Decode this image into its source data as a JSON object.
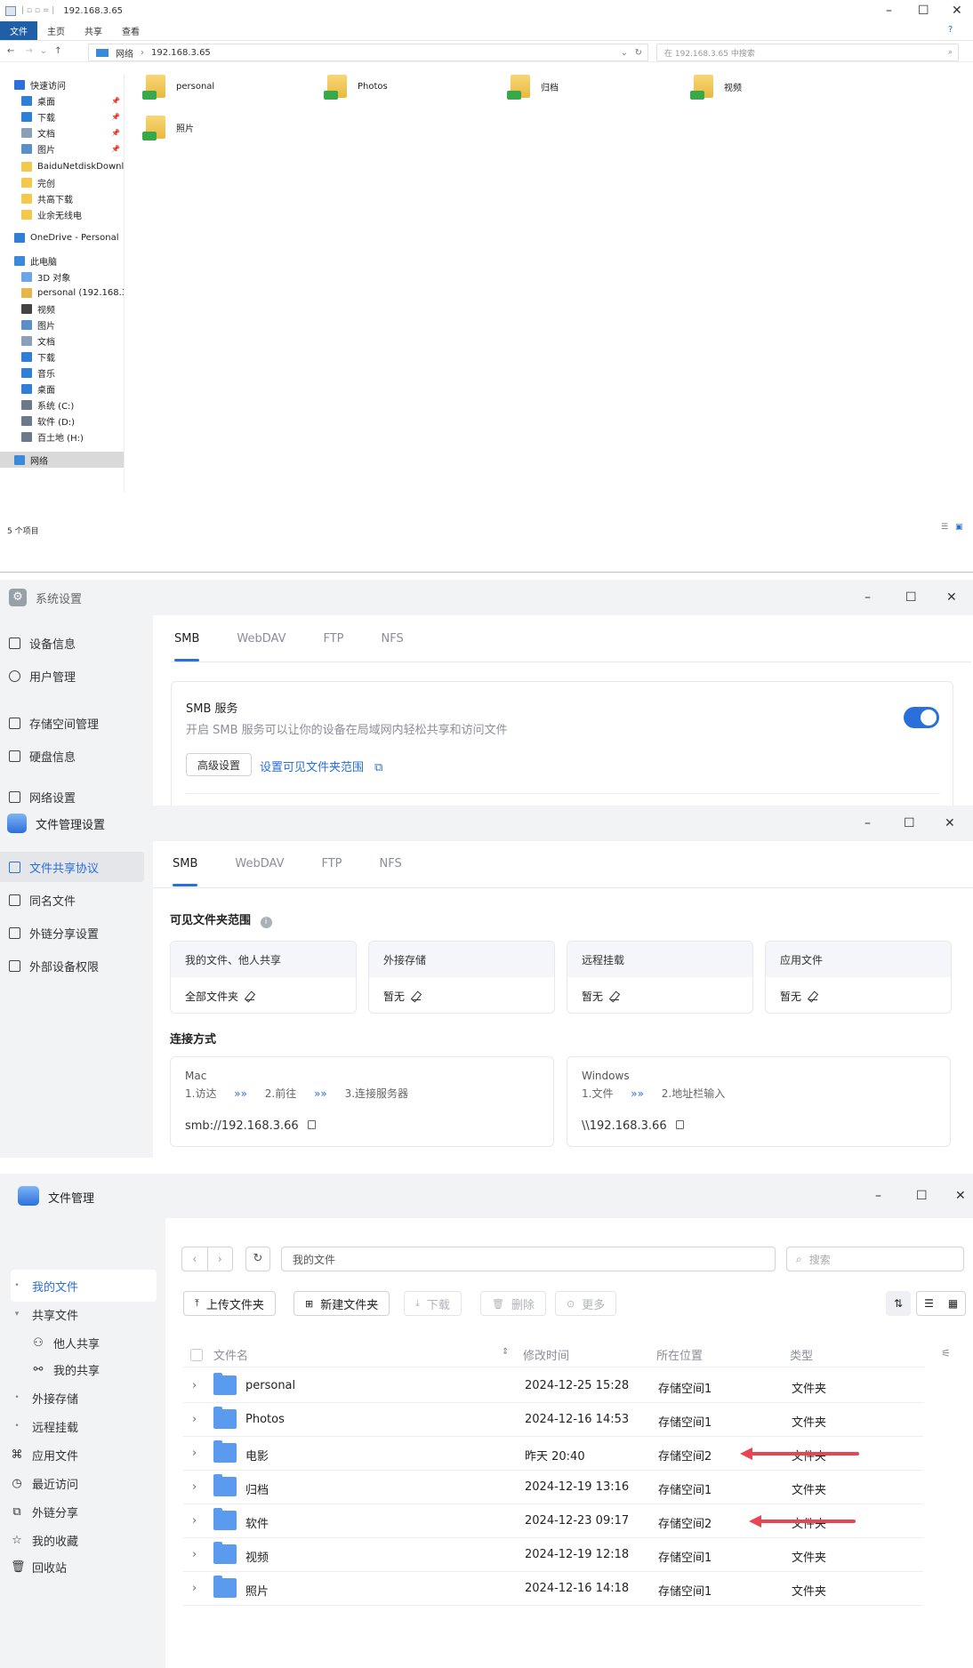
{
  "explorer": {
    "title": "192.168.3.65",
    "ribbon_tabs": [
      "文件",
      "主页",
      "共享",
      "查看"
    ],
    "breadcrumb_root": "网络",
    "breadcrumb_path": "192.168.3.65",
    "search_placeholder": "在 192.168.3.65 中搜索",
    "nav": [
      {
        "label": "快速访问",
        "icon": "star-icon",
        "color": "#2a6fdb",
        "pinned": false
      },
      {
        "label": "桌面",
        "icon": "desktop-icon",
        "color": "#2f7fd6",
        "pinned": true
      },
      {
        "label": "下载",
        "icon": "download-icon",
        "color": "#2f7fd6",
        "pinned": true
      },
      {
        "label": "文档",
        "icon": "document-icon",
        "color": "#8aa0b8",
        "pinned": true
      },
      {
        "label": "图片",
        "icon": "picture-icon",
        "color": "#5b8fc8",
        "pinned": true
      },
      {
        "label": "BaiduNetdiskDownlo",
        "icon": "folder-icon",
        "color": "#f2c94c",
        "pinned": false
      },
      {
        "label": "完创",
        "icon": "folder-icon",
        "color": "#f2c94c",
        "pinned": false
      },
      {
        "label": "共高下载",
        "icon": "folder-icon",
        "color": "#f2c94c",
        "pinned": false
      },
      {
        "label": "业余无线电",
        "icon": "folder-icon",
        "color": "#f2c94c",
        "pinned": false
      },
      {
        "label": "OneDrive - Personal",
        "icon": "cloud-icon",
        "color": "#2f7fd6",
        "pinned": false
      },
      {
        "label": "此电脑",
        "icon": "computer-icon",
        "color": "#3b8ad9",
        "pinned": false
      },
      {
        "label": "3D 对象",
        "icon": "cube-icon",
        "color": "#6aa6e8",
        "pinned": false
      },
      {
        "label": "personal (192.168.3.6",
        "icon": "network-drive-icon",
        "color": "#e5b64a",
        "pinned": false
      },
      {
        "label": "视频",
        "icon": "video-icon",
        "color": "#444",
        "pinned": false
      },
      {
        "label": "图片",
        "icon": "picture-icon",
        "color": "#5b8fc8",
        "pinned": false
      },
      {
        "label": "文档",
        "icon": "document-icon",
        "color": "#8aa0b8",
        "pinned": false
      },
      {
        "label": "下载",
        "icon": "download-icon",
        "color": "#2f7fd6",
        "pinned": false
      },
      {
        "label": "音乐",
        "icon": "music-icon",
        "color": "#2f7fd6",
        "pinned": false
      },
      {
        "label": "桌面",
        "icon": "desktop-icon",
        "color": "#2f7fd6",
        "pinned": false
      },
      {
        "label": "系统 (C:)",
        "icon": "drive-icon",
        "color": "#6a7a8a",
        "pinned": false
      },
      {
        "label": "软件 (D:)",
        "icon": "drive-icon",
        "color": "#6a7a8a",
        "pinned": false
      },
      {
        "label": "百土地 (H:)",
        "icon": "drive-icon",
        "color": "#6a7a8a",
        "pinned": false
      },
      {
        "label": "网络",
        "icon": "network-icon",
        "color": "#3b8ad9",
        "pinned": false
      }
    ],
    "folders": [
      "personal",
      "Photos",
      "归档",
      "视频",
      "照片"
    ],
    "status": "5 个项目"
  },
  "sys_settings": {
    "title": "系统设置",
    "sidebar": [
      "设备信息",
      "用户管理",
      "存储空间管理",
      "硬盘信息",
      "网络设置"
    ],
    "tabs": [
      "SMB",
      "WebDAV",
      "FTP",
      "NFS"
    ],
    "smb_title": "SMB 服务",
    "smb_desc": "开启 SMB 服务可以让你的设备在局域网内轻松共享和访问文件",
    "advanced_btn": "高级设置",
    "scope_link": "设置可见文件夹范围"
  },
  "file_settings": {
    "title": "文件管理设置",
    "sidebar": [
      "文件共享协议",
      "同名文件",
      "外链分享设置",
      "外部设备权限"
    ],
    "tabs": [
      "SMB",
      "WebDAV",
      "FTP",
      "NFS"
    ],
    "scope_heading": "可见文件夹范围",
    "scope_cards": [
      {
        "head": "我的文件、他人共享",
        "value": "全部文件夹"
      },
      {
        "head": "外接存储",
        "value": "暂无"
      },
      {
        "head": "远程挂载",
        "value": "暂无"
      },
      {
        "head": "应用文件",
        "value": "暂无"
      }
    ],
    "connect_heading": "连接方式",
    "mac": {
      "os": "Mac",
      "steps": [
        "1.访达",
        "2.前往",
        "3.连接服务器"
      ],
      "address": "smb://192.168.3.66"
    },
    "windows": {
      "os": "Windows",
      "steps": [
        "1.文件",
        "2.地址栏输入"
      ],
      "address": "\\\\192.168.3.66"
    },
    "step_sep": "»»"
  },
  "file_manager": {
    "title": "文件管理",
    "sidebar": [
      {
        "label": "我的文件",
        "prefix": "•",
        "active": true
      },
      {
        "label": "共享文件",
        "prefix": "▾",
        "active": false
      },
      {
        "label": "他人共享",
        "prefix": "",
        "active": false
      },
      {
        "label": "我的共享",
        "prefix": "",
        "active": false
      },
      {
        "label": "外接存储",
        "prefix": "•",
        "active": false
      },
      {
        "label": "远程挂载",
        "prefix": "•",
        "active": false
      },
      {
        "label": "应用文件",
        "prefix": "",
        "active": false
      },
      {
        "label": "最近访问",
        "prefix": "",
        "active": false
      },
      {
        "label": "外链分享",
        "prefix": "",
        "active": false
      },
      {
        "label": "我的收藏",
        "prefix": "",
        "active": false
      },
      {
        "label": "回收站",
        "prefix": "",
        "active": false
      }
    ],
    "path": "我的文件",
    "search_placeholder": "搜索",
    "toolbar": [
      "上传文件夹",
      "新建文件夹",
      "下载",
      "删除",
      "更多"
    ],
    "columns": [
      "文件名",
      "修改时间",
      "所在位置",
      "类型"
    ],
    "rows": [
      {
        "name": "personal",
        "modified": "2024-12-25 15:28",
        "location": "存储空间1",
        "type": "文件夹"
      },
      {
        "name": "Photos",
        "modified": "2024-12-16 14:53",
        "location": "存储空间1",
        "type": "文件夹"
      },
      {
        "name": "电影",
        "modified": "昨天 20:40",
        "location": "存储空间2",
        "type": "文件夹"
      },
      {
        "name": "归档",
        "modified": "2024-12-19 13:16",
        "location": "存储空间1",
        "type": "文件夹"
      },
      {
        "name": "软件",
        "modified": "2024-12-23 09:17",
        "location": "存储空间2",
        "type": "文件夹"
      },
      {
        "name": "视频",
        "modified": "2024-12-19 12:18",
        "location": "存储空间1",
        "type": "文件夹"
      },
      {
        "name": "照片",
        "modified": "2024-12-16 14:18",
        "location": "存储空间1",
        "type": "文件夹"
      }
    ]
  },
  "colors": {
    "accent": "#2a6fdb",
    "annotation_arrow": "#e84553",
    "sidebar_bg": "#f2f3f5"
  }
}
